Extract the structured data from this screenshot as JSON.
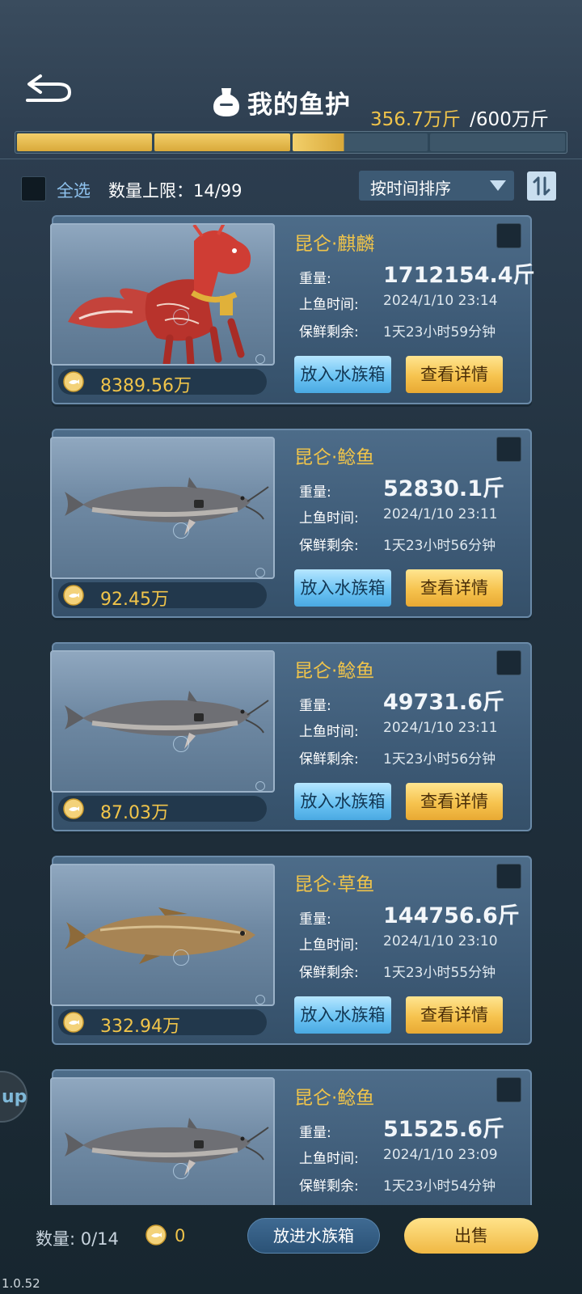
{
  "header": {
    "title": "我的鱼护",
    "capacity_current": "356.7万斤",
    "capacity_sep": "/",
    "capacity_max": "600万斤",
    "capacity_fraction": 0.5945,
    "progress_colors": {
      "filled": "#f0c44a",
      "empty": "#3d5669"
    }
  },
  "toolbar": {
    "select_all": "全选",
    "limit_label": "数量上限：14/99",
    "sort_label": "按时间排序"
  },
  "labels": {
    "weight": "重量:",
    "catch_time": "上鱼时间:",
    "fresh_remaining": "保鲜剩余:",
    "btn_aquarium": "放入水族箱",
    "btn_detail": "查看详情"
  },
  "fish": [
    {
      "name": "昆仑·麒麟",
      "weight": "1712154.4斤",
      "time": "2024/1/10  23:14",
      "fresh": "1天23小时59分钟",
      "value": "8389.56万",
      "art": "qilin"
    },
    {
      "name": "昆仑·鲶鱼",
      "weight": "52830.1斤",
      "time": "2024/1/10  23:11",
      "fresh": "1天23小时56分钟",
      "value": "92.45万",
      "art": "catfish"
    },
    {
      "name": "昆仑·鲶鱼",
      "weight": "49731.6斤",
      "time": "2024/1/10  23:11",
      "fresh": "1天23小时56分钟",
      "value": "87.03万",
      "art": "catfish"
    },
    {
      "name": "昆仑·草鱼",
      "weight": "144756.6斤",
      "time": "2024/1/10  23:10",
      "fresh": "1天23小时55分钟",
      "value": "332.94万",
      "art": "grasscarp"
    },
    {
      "name": "昆仑·鲶鱼",
      "weight": "51525.6斤",
      "time": "2024/1/10  23:09",
      "fresh": "1天23小时54分钟",
      "value": "",
      "art": "catfish"
    }
  ],
  "side": {
    "up_label": "up"
  },
  "footer": {
    "qty_label": "数量:  0/14",
    "coin_amount": "0",
    "put_button": "放进水族箱",
    "sell_button": "出售"
  },
  "version": "1.0.52"
}
